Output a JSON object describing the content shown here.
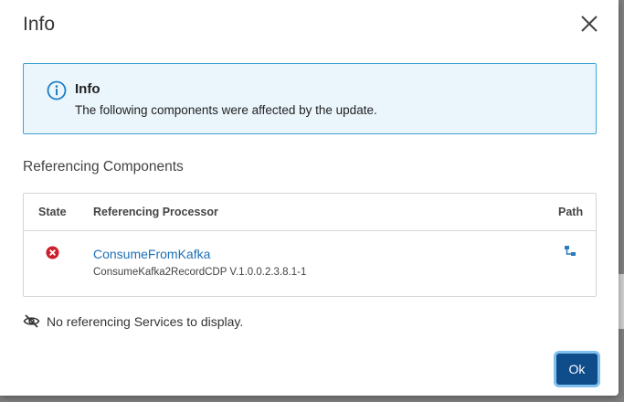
{
  "dialog": {
    "title": "Info",
    "close_label": "close"
  },
  "info": {
    "title": "Info",
    "message": "The following components were affected by the update."
  },
  "referencing": {
    "title": "Referencing Components",
    "columns": {
      "state": "State",
      "processor": "Referencing Processor",
      "path": "Path"
    },
    "rows": [
      {
        "state": "error",
        "name": "ConsumeFromKafka",
        "type": "ConsumeKafka2RecordCDP V.1.0.0.2.3.8.1-1"
      }
    ]
  },
  "services": {
    "empty_message": "No referencing Services to display."
  },
  "footer": {
    "ok_label": "Ok"
  },
  "icons": {
    "close": "close-icon",
    "info": "info-circle-icon",
    "state": "error-circle-icon",
    "path": "go-to-path-icon",
    "empty": "eye-slash-icon"
  },
  "colors": {
    "accent": "#0f4c8a",
    "link": "#1e6fb5",
    "info_border": "#3fa3d6",
    "info_bg": "#eaf6fc",
    "error": "#cc1f2b"
  }
}
